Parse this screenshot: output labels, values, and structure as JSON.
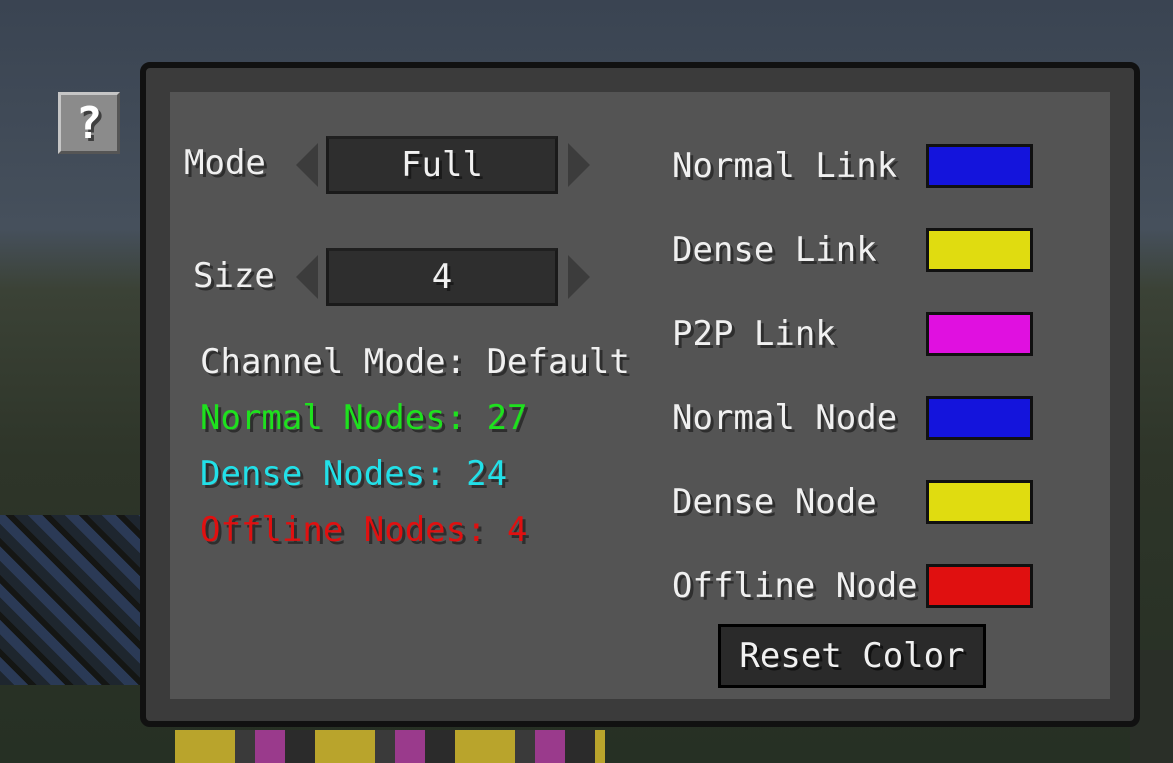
{
  "help_button": {
    "label": "?"
  },
  "mode": {
    "label": "Mode",
    "value": "Full"
  },
  "size": {
    "label": "Size",
    "value": "4"
  },
  "stats": {
    "channel_mode": "Channel Mode: Default",
    "normal_nodes": "Normal Nodes: 27",
    "dense_nodes": "Dense Nodes: 24",
    "offline_nodes": "Offline Nodes: 4",
    "colors": {
      "normal": "#1ee11e",
      "dense": "#22e0e8",
      "offline": "#e01010"
    }
  },
  "color_settings": [
    {
      "label": "Normal Link",
      "color": "#1414dc"
    },
    {
      "label": "Dense Link",
      "color": "#e0dc10"
    },
    {
      "label": "P2P Link",
      "color": "#e010e0"
    },
    {
      "label": "Normal Node",
      "color": "#1414dc"
    },
    {
      "label": "Dense Node",
      "color": "#e0dc10"
    },
    {
      "label": "Offline Node",
      "color": "#e01010"
    }
  ],
  "reset_button": {
    "label": "Reset Color"
  }
}
